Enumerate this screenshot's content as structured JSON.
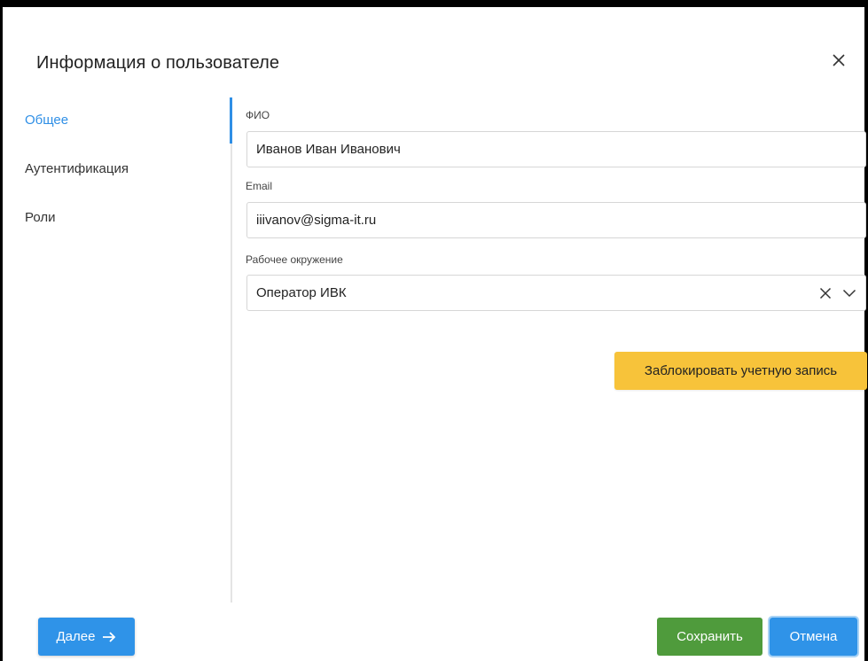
{
  "dialog": {
    "title": "Информация о пользователе",
    "close_icon": "close-icon"
  },
  "nav": {
    "items": [
      {
        "label": "Общее",
        "active": true
      },
      {
        "label": "Аутентификация",
        "active": false
      },
      {
        "label": "Роли",
        "active": false
      }
    ]
  },
  "form": {
    "fio": {
      "label": "ФИО",
      "value": "Иванов Иван Иванович"
    },
    "email": {
      "label": "Email",
      "value": "iiivanov@sigma-it.ru"
    },
    "environment": {
      "label": "Рабочее окружение",
      "value": "Оператор ИВК",
      "clear_icon": "clear-icon",
      "dropdown_icon": "chevron-down-icon"
    },
    "lock_button": "Заблокировать учетную запись"
  },
  "footer": {
    "next_label": "Далее",
    "next_icon": "arrow-right-icon",
    "save_label": "Сохранить",
    "cancel_label": "Отмена"
  },
  "colors": {
    "accent": "#2f8fe6",
    "warning": "#f7c33a",
    "success": "#4f9b3c"
  }
}
